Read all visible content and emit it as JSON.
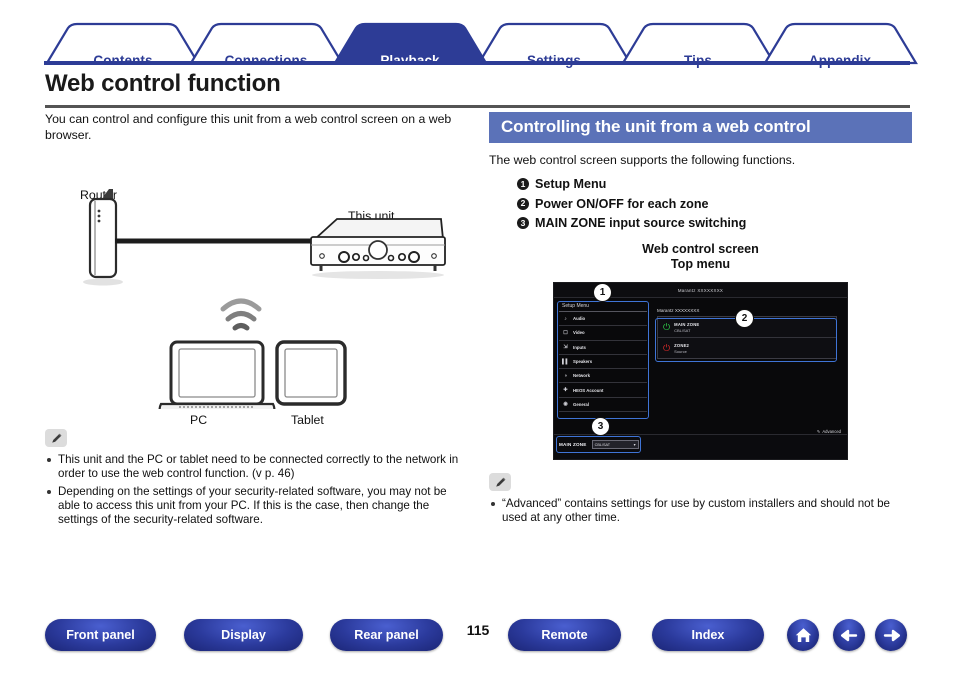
{
  "tabs": [
    {
      "label": "Contents",
      "active": false
    },
    {
      "label": "Connections",
      "active": false
    },
    {
      "label": "Playback",
      "active": true
    },
    {
      "label": "Settings",
      "active": false
    },
    {
      "label": "Tips",
      "active": false
    },
    {
      "label": "Appendix",
      "active": false
    }
  ],
  "page": {
    "title": "Web control function",
    "intro": "You can control and configure this unit from a web control screen on a web browser."
  },
  "diagram": {
    "router_label": "Router",
    "unit_label": "This unit",
    "pc_label": "PC",
    "tablet_label": "Tablet"
  },
  "left_notes": [
    "This unit and the PC or tablet need to be connected correctly to the network in order to use the web control function. (v p. 46)",
    "Depending on the settings of your security-related software, you may not be able to access this unit from your PC. If this is the case, then change the settings of the security-related software."
  ],
  "section": {
    "heading": "Controlling the unit from a web control",
    "intro": "The web control screen supports the following functions.",
    "functions": [
      {
        "num": "1",
        "label": "Setup Menu"
      },
      {
        "num": "2",
        "label": "Power ON/OFF for each zone"
      },
      {
        "num": "3",
        "label": "MAIN ZONE input source switching"
      }
    ],
    "caption_line1": "Web control screen",
    "caption_line2": "Top menu"
  },
  "mock": {
    "titlebar": "Marantz XXXXXXXX",
    "sidebar_header": "Setup Menu",
    "sidebar_items": [
      {
        "label": "Audio",
        "icon": "note-icon"
      },
      {
        "label": "Video",
        "icon": "monitor-icon"
      },
      {
        "label": "Inputs",
        "icon": "input-icon"
      },
      {
        "label": "Speakers",
        "icon": "speaker-icon"
      },
      {
        "label": "Network",
        "icon": "wifi-icon"
      },
      {
        "label": "HEOS Account",
        "icon": "heos-icon"
      },
      {
        "label": "General",
        "icon": "gear-icon"
      }
    ],
    "device_name": "Marantz XXXXXXXX",
    "zones": [
      {
        "name": "MAIN ZONE",
        "source": "CBL/SAT",
        "power": "on"
      },
      {
        "name": "ZONE2",
        "source": "Source",
        "power": "off"
      }
    ],
    "advanced_label": "Advanced",
    "bottom_zone_label": "MAIN ZONE",
    "bottom_select_value": "CBL/SAT",
    "callout_numbers": [
      "1",
      "2",
      "3"
    ]
  },
  "right_notes": [
    "“Advanced” contains settings for use by custom installers and should not be used at any other time."
  ],
  "footer": {
    "buttons": [
      "Front panel",
      "Display",
      "Rear panel",
      "Remote",
      "Index"
    ],
    "page_number": "115",
    "nav_icons": [
      "home-icon",
      "back-arrow-icon",
      "forward-arrow-icon"
    ]
  },
  "colors": {
    "tab_active": "#2d3c96",
    "section_head": "#5b72b8",
    "callout": "#3f74d6",
    "power_on": "#2fd14a",
    "power_off": "#e02b2b"
  }
}
